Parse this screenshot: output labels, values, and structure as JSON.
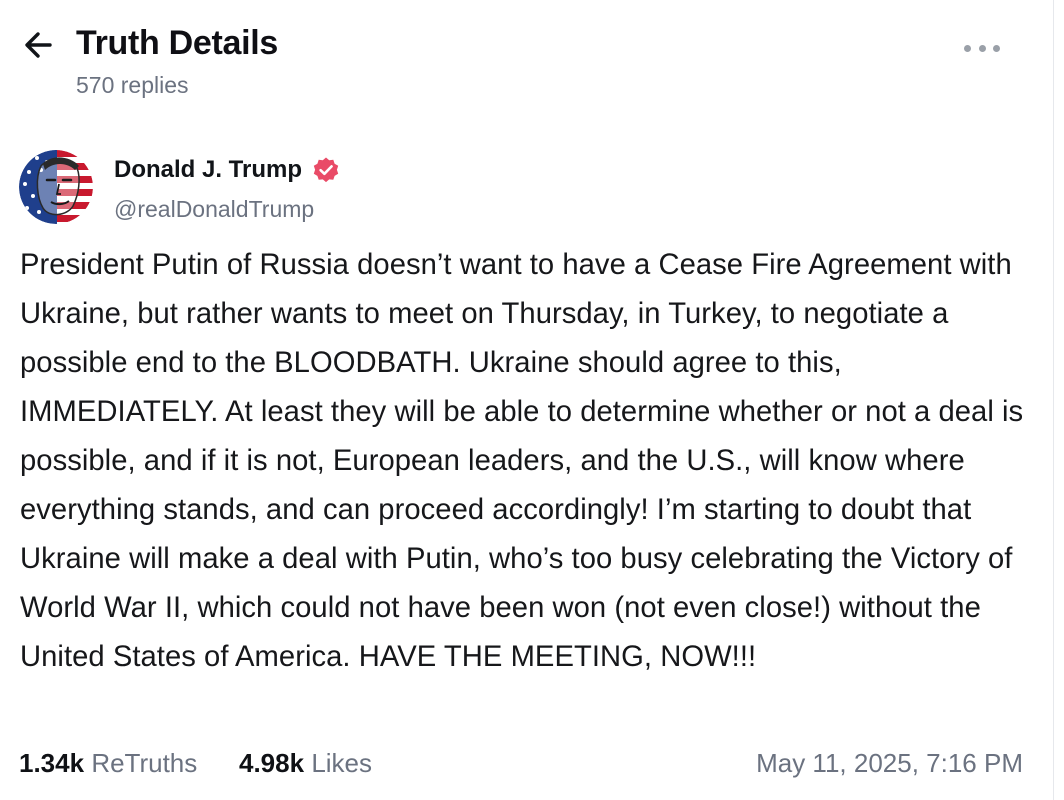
{
  "header": {
    "title": "Truth Details",
    "replies": "570 replies"
  },
  "author": {
    "display_name": "Donald J. Trump",
    "handle": "@realDonaldTrump",
    "verified": true,
    "verified_color": "#e94b67"
  },
  "post": {
    "text": "President Putin of Russia doesn’t want to have a Cease Fire Agreement with Ukraine, but rather wants to meet on Thursday, in Turkey, to negotiate a possible end to the BLOODBATH. Ukraine should agree to this, IMMEDIATELY. At least they will be able to determine whether or not a deal is possible, and if it is not, European leaders, and the U.S., will know where everything stands, and can proceed accordingly! I’m starting to doubt that Ukraine will make a deal with Putin, who’s too busy celebrating the Victory of World War II, which could not have been won (not even close!) without the United States of America. HAVE THE MEETING, NOW!!!"
  },
  "stats": {
    "retruths_count": "1.34k",
    "retruths_label": "ReTruths",
    "likes_count": "4.98k",
    "likes_label": "Likes",
    "timestamp": "May 11, 2025, 7:16 PM"
  },
  "icons": {
    "back": "arrow-left-icon",
    "more": "more-horizontal-icon",
    "verified": "verified-badge-icon"
  },
  "colors": {
    "text_primary": "#0f1419",
    "text_secondary": "#6b7280",
    "verified_badge": "#e94b67",
    "more_dots": "#9aa0a8"
  }
}
